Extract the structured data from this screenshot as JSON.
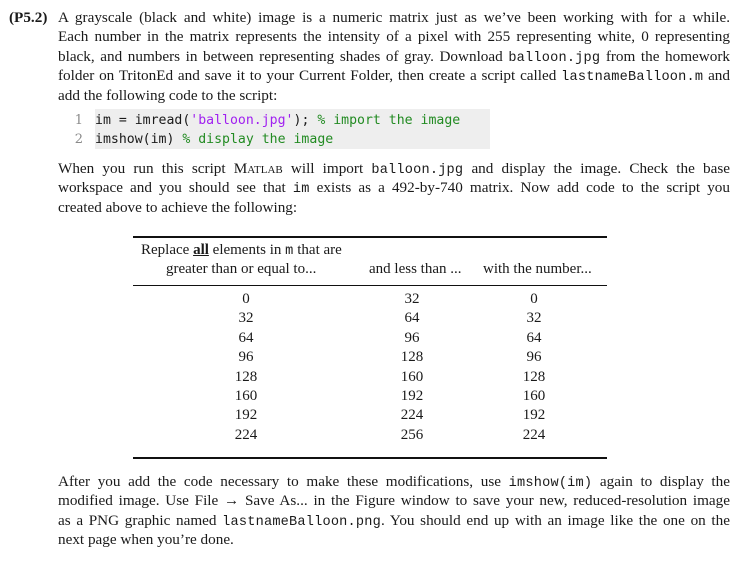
{
  "problem_label": "(P5.2)",
  "para1": {
    "line1": "A grayscale (black and white) image is a numeric matrix just as we’ve been working with for a while.",
    "line2": "Each number in the matrix represents the intensity of a pixel with 255 representing white, 0 representing",
    "line3_pre": "black, and numbers in between representing shades of gray. Download ",
    "line3_code": "balloon.jpg",
    "line3_post": " from the homework",
    "line4_pre": "folder on TritonEd and save it to your Current Folder, then create a script called ",
    "line4_code": "lastnameBalloon.m",
    "line4_post": " and",
    "line5": "add the following code to the script:"
  },
  "code": {
    "lines": [
      {
        "number": "1",
        "plain_pre": "im = imread(",
        "string": "'balloon.jpg'",
        "plain_post": "); ",
        "comment": "% import the image"
      },
      {
        "number": "2",
        "plain_pre": "imshow(im) ",
        "string": "",
        "plain_post": "",
        "comment": "% display the image"
      }
    ]
  },
  "para2": {
    "line1_pre": "When you run this script ",
    "line1_matlab": "Matlab",
    "line1_mid": " will import ",
    "line1_code": "balloon.jpg",
    "line1_post": " and display the image.  Check the base",
    "line2_pre": "workspace and you should see that ",
    "line2_code": "im",
    "line2_post": " exists as a 492-by-740 matrix.  Now add code to the script you",
    "line3": "created above to achieve the following:"
  },
  "table": {
    "header": {
      "col1_line1_pre": "Replace ",
      "col1_line1_emph": "all",
      "col1_line1_mid": " elements in ",
      "col1_line1_code": "m",
      "col1_line1_post": " that are",
      "col1_line2": "greater than or equal to...",
      "col2": "and less than ...",
      "col3": "with the number..."
    },
    "rows": [
      [
        "0",
        "32",
        "0"
      ],
      [
        "32",
        "64",
        "32"
      ],
      [
        "64",
        "96",
        "64"
      ],
      [
        "96",
        "128",
        "96"
      ],
      [
        "128",
        "160",
        "128"
      ],
      [
        "160",
        "192",
        "160"
      ],
      [
        "192",
        "224",
        "192"
      ],
      [
        "224",
        "256",
        "224"
      ]
    ]
  },
  "para3": {
    "line1_pre": "After you add the code necessary to make these modifications, use ",
    "line1_code": "imshow(im)",
    "line1_post": " again to display the",
    "line2": "modified image. Use File → Save As... in the Figure window to save your new, reduced-resolution image",
    "line3_pre": "as a PNG graphic named ",
    "line3_code": "lastnameBalloon.png",
    "line3_post": ".  You should end up with an image like the one on the",
    "line4": "next page when you’re done."
  },
  "colors": {
    "code_background": "#eeeeee",
    "code_string": "#a020f0",
    "code_comment": "#228b22",
    "line_number": "#8a8a8a"
  }
}
